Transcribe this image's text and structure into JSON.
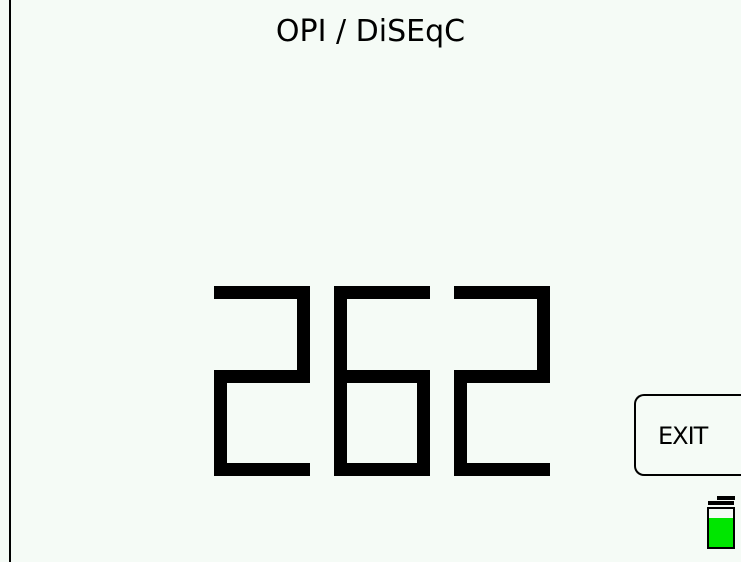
{
  "screen": {
    "title": "OPI / DiSEqC",
    "value": "262"
  },
  "exit_button": {
    "label": "EXIT"
  },
  "battery": {
    "icon": "battery-icon",
    "fill_fraction": 0.75,
    "color": "#00e600"
  },
  "colors": {
    "background": "#f5fbf6",
    "foreground": "#000000"
  }
}
